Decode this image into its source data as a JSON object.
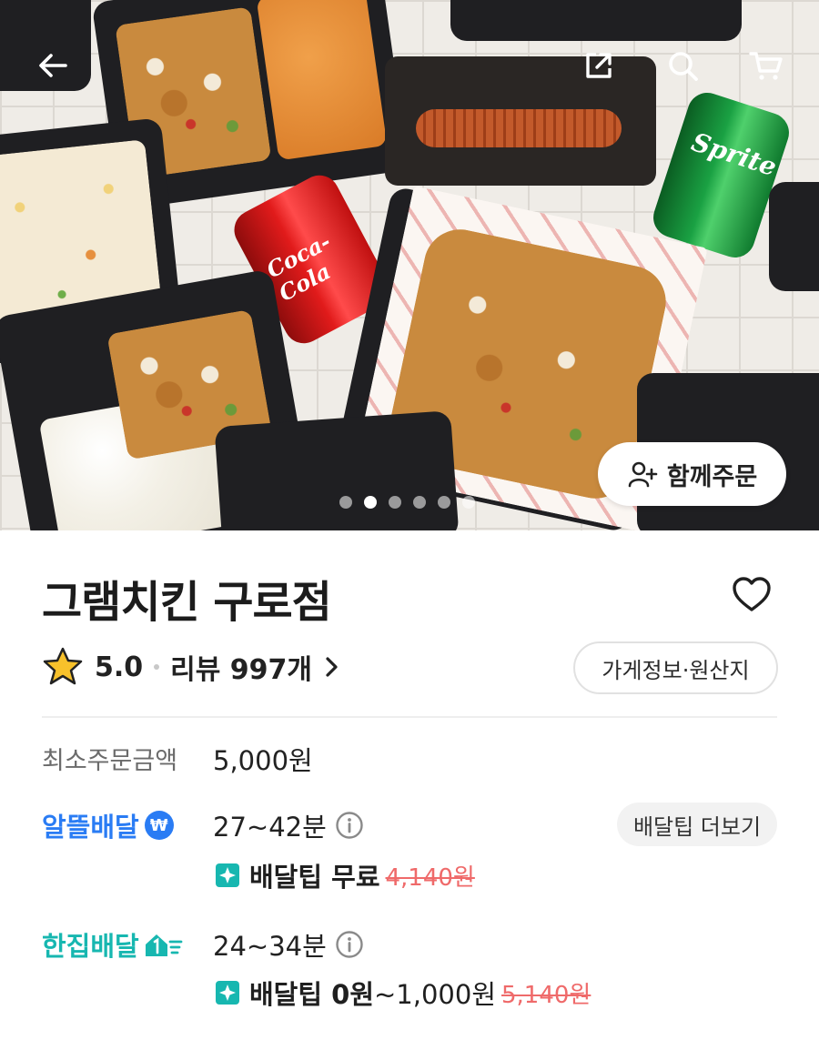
{
  "hero": {
    "image_desc_icon": "food-photo",
    "carousel": {
      "total": 6,
      "active": 2
    },
    "together_order_label": "함께주문",
    "can1_text": "Coca-Cola",
    "can2_text": "Sprite"
  },
  "topbar": {
    "back_icon": "arrow-left-icon",
    "share_icon": "share-icon",
    "search_icon": "search-icon",
    "cart_icon": "cart-icon"
  },
  "store": {
    "name": "그램치킨 구로점",
    "rating": "5.0",
    "review_label": "리뷰 997개",
    "info_button": "가게정보·원산지"
  },
  "order": {
    "min_order_label": "최소주문금액",
    "min_order_value": "5,000원"
  },
  "delivery": {
    "saver": {
      "label": "알뜰배달",
      "badge": "₩",
      "time": "27~42분",
      "tip_label": "배달팁 무료",
      "tip_original": "4,140원"
    },
    "single": {
      "label": "한집배달",
      "time": "24~34분",
      "tip_label": "배달팁 0원",
      "tip_range": "~1,000원",
      "tip_original": "5,140원"
    },
    "tip_more_button": "배달팁 더보기"
  },
  "colors": {
    "saver_blue": "#2a7cf4",
    "single_teal": "#17b7b0",
    "strike_red": "#ef6a6a"
  }
}
